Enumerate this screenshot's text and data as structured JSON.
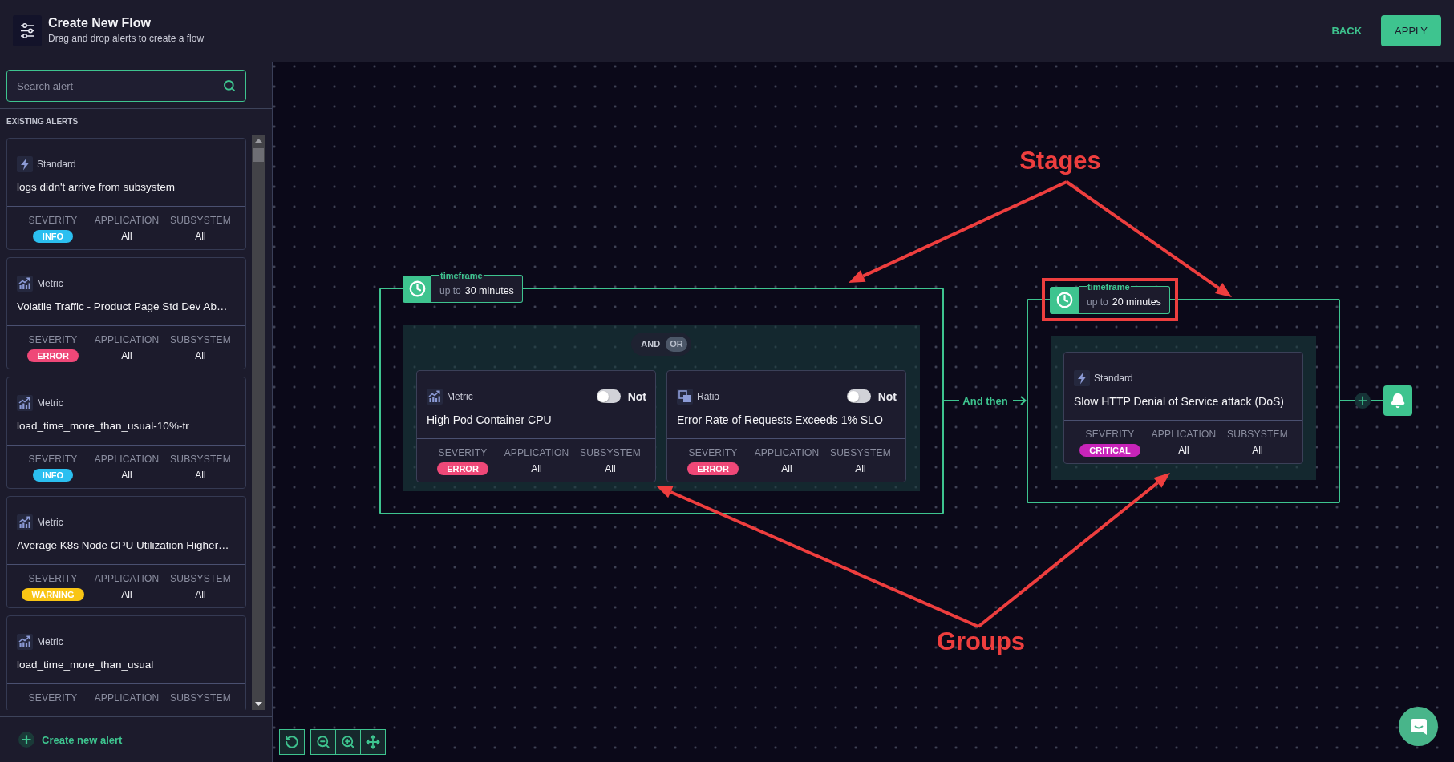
{
  "header": {
    "title": "Create New Flow",
    "subtitle": "Drag and drop alerts to create a flow",
    "actions": [
      {
        "label": "BACK",
        "kind": "text"
      },
      {
        "label": "APPLY",
        "kind": "primary"
      }
    ]
  },
  "sidebar": {
    "search": {
      "placeholder": "Search alert"
    },
    "section_title": "EXISTING ALERTS",
    "alerts": [
      {
        "kind": "standard",
        "type": "Standard",
        "title": "logs didn't arrive from subsystem",
        "fields": [
          {
            "kind": "badge",
            "label": "SEVERITY",
            "value": "INFO",
            "color": "#2bbff0"
          },
          {
            "kind": "text",
            "label": "APPLICATION",
            "value": "All"
          },
          {
            "kind": "text",
            "label": "SUBSYSTEM",
            "value": "All"
          }
        ]
      },
      {
        "kind": "metric",
        "type": "Metric",
        "title": "Volatile Traffic - Product Page Std Dev Ab…",
        "fields": [
          {
            "kind": "badge",
            "label": "SEVERITY",
            "value": "ERROR",
            "color": "#ef4878"
          },
          {
            "kind": "text",
            "label": "APPLICATION",
            "value": "All"
          },
          {
            "kind": "text",
            "label": "SUBSYSTEM",
            "value": "All"
          }
        ]
      },
      {
        "kind": "metric",
        "type": "Metric",
        "title": "load_time_more_than_usual-10%-tr",
        "fields": [
          {
            "kind": "badge",
            "label": "SEVERITY",
            "value": "INFO",
            "color": "#2bbff0"
          },
          {
            "kind": "text",
            "label": "APPLICATION",
            "value": "All"
          },
          {
            "kind": "text",
            "label": "SUBSYSTEM",
            "value": "All"
          }
        ]
      },
      {
        "kind": "metric",
        "type": "Metric",
        "title": "Average K8s Node CPU Utilization Higher…",
        "fields": [
          {
            "kind": "badge",
            "label": "SEVERITY",
            "value": "WARNING",
            "color": "#f9c514"
          },
          {
            "kind": "text",
            "label": "APPLICATION",
            "value": "All"
          },
          {
            "kind": "text",
            "label": "SUBSYSTEM",
            "value": "All"
          }
        ]
      },
      {
        "kind": "metric",
        "type": "Metric",
        "title": "load_time_more_than_usual",
        "fields": [
          {
            "label": "SEVERITY"
          },
          {
            "label": "APPLICATION"
          },
          {
            "label": "SUBSYSTEM"
          }
        ]
      }
    ],
    "create_label": "Create new alert"
  },
  "flow": {
    "stages": [
      {
        "timeframe": {
          "legend": "timeframe",
          "prefix": "up to",
          "value": "30 minutes"
        },
        "highlighted": false,
        "group": {
          "operators": [
            {
              "label": "AND",
              "selected": false
            },
            {
              "label": "OR",
              "selected": true
            }
          ],
          "alerts": [
            {
              "kind": "metric",
              "type": "Metric",
              "title": "High Pod Container CPU",
              "negate": {
                "label": "Not",
                "on": false
              },
              "fields": [
                {
                  "kind": "badge",
                  "label": "SEVERITY",
                  "value": "ERROR",
                  "color": "#ef4878"
                },
                {
                  "kind": "text",
                  "label": "APPLICATION",
                  "value": "All"
                },
                {
                  "kind": "text",
                  "label": "SUBSYSTEM",
                  "value": "All"
                }
              ]
            },
            {
              "kind": "ratio",
              "type": "Ratio",
              "title": "Error Rate of Requests Exceeds 1% SLO",
              "negate": {
                "label": "Not",
                "on": false
              },
              "fields": [
                {
                  "kind": "badge",
                  "label": "SEVERITY",
                  "value": "ERROR",
                  "color": "#ef4878"
                },
                {
                  "kind": "text",
                  "label": "APPLICATION",
                  "value": "All"
                },
                {
                  "kind": "text",
                  "label": "SUBSYSTEM",
                  "value": "All"
                }
              ]
            }
          ]
        }
      },
      {
        "timeframe": {
          "legend": "timeframe",
          "prefix": "up to",
          "value": "20 minutes"
        },
        "highlighted": true,
        "group": {
          "alerts": [
            {
              "kind": "standard",
              "type": "Standard",
              "title": "Slow HTTP Denial of Service attack (DoS)",
              "fields": [
                {
                  "kind": "badge",
                  "label": "SEVERITY",
                  "value": "CRITICAL",
                  "color": "#c824b9"
                },
                {
                  "kind": "text",
                  "label": "APPLICATION",
                  "value": "All"
                },
                {
                  "kind": "text",
                  "label": "SUBSYSTEM",
                  "value": "All"
                }
              ]
            }
          ]
        }
      }
    ],
    "connectors": [
      {
        "label": "And then"
      }
    ]
  },
  "annotations": [
    {
      "kind": "stages",
      "text": "Stages"
    },
    {
      "kind": "groups",
      "text": "Groups"
    }
  ]
}
